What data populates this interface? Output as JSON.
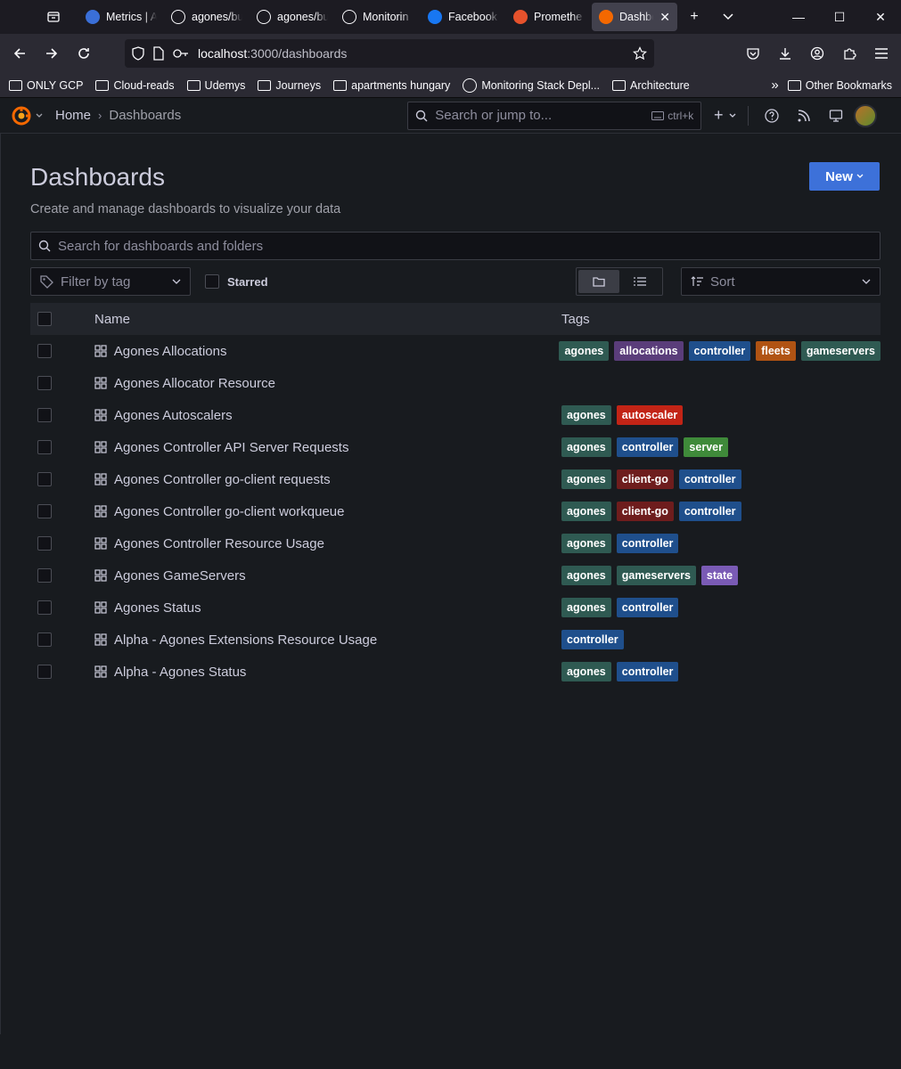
{
  "browser": {
    "tabs": [
      {
        "title": "Metrics | A",
        "icon": "azure-metrics-icon",
        "color": "#3a6fd8",
        "active": false
      },
      {
        "title": "agones/bu",
        "icon": "github-icon",
        "color": "#ffffff",
        "active": false
      },
      {
        "title": "agones/bu",
        "icon": "github-icon",
        "color": "#ffffff",
        "active": false
      },
      {
        "title": "Monitorin",
        "icon": "openai-icon",
        "color": "#ffffff",
        "active": false
      },
      {
        "title": "Facebook",
        "icon": "facebook-icon",
        "color": "#1877f2",
        "active": false
      },
      {
        "title": "Promethe",
        "icon": "prometheus-icon",
        "color": "#e6522c",
        "active": false
      },
      {
        "title": "Dashbo",
        "icon": "grafana-icon",
        "color": "#f46800",
        "active": true
      }
    ],
    "url_host": "localhost",
    "url_path": ":3000/dashboards",
    "bookmarks": [
      {
        "label": "ONLY GCP",
        "type": "folder"
      },
      {
        "label": "Cloud-reads",
        "type": "folder"
      },
      {
        "label": "Udemys",
        "type": "folder"
      },
      {
        "label": "Journeys",
        "type": "folder"
      },
      {
        "label": "apartments hungary",
        "type": "folder"
      },
      {
        "label": "Monitoring Stack Depl...",
        "type": "link"
      },
      {
        "label": "Architecture",
        "type": "folder"
      }
    ],
    "other_bookmarks": "Other Bookmarks"
  },
  "topbar": {
    "home": "Home",
    "current": "Dashboards",
    "search_placeholder": "Search or jump to...",
    "shortcut": "ctrl+k"
  },
  "page": {
    "title": "Dashboards",
    "subtitle": "Create and manage dashboards to visualize your data",
    "new_button": "New",
    "search_placeholder": "Search for dashboards and folders",
    "filter_by_tag": "Filter by tag",
    "starred": "Starred",
    "sort": "Sort",
    "col_name": "Name",
    "col_tags": "Tags"
  },
  "tag_colors": {
    "agones": "#2f5a52",
    "allocations": "#5a3d7a",
    "controller": "#1f4f8c",
    "fleets": "#b05313",
    "gameservers": "#2f5a52",
    "autoscaler": "#c22416",
    "server": "#3f8a3a",
    "client-go": "#6e1d1d",
    "state": "#7a5bb5"
  },
  "dashboards": [
    {
      "name": "Agones Allocations",
      "tags": [
        "agones",
        "allocations",
        "controller",
        "fleets",
        "gameservers"
      ]
    },
    {
      "name": "Agones Allocator Resource",
      "tags": []
    },
    {
      "name": "Agones Autoscalers",
      "tags": [
        "agones",
        "autoscaler"
      ]
    },
    {
      "name": "Agones Controller API Server Requests",
      "tags": [
        "agones",
        "controller",
        "server"
      ]
    },
    {
      "name": "Agones Controller go-client requests",
      "tags": [
        "agones",
        "client-go",
        "controller"
      ]
    },
    {
      "name": "Agones Controller go-client workqueue",
      "tags": [
        "agones",
        "client-go",
        "controller"
      ]
    },
    {
      "name": "Agones Controller Resource Usage",
      "tags": [
        "agones",
        "controller"
      ]
    },
    {
      "name": "Agones GameServers",
      "tags": [
        "agones",
        "gameservers",
        "state"
      ]
    },
    {
      "name": "Agones Status",
      "tags": [
        "agones",
        "controller"
      ]
    },
    {
      "name": "Alpha - Agones Extensions Resource Usage",
      "tags": [
        "controller"
      ]
    },
    {
      "name": "Alpha - Agones Status",
      "tags": [
        "agones",
        "controller"
      ]
    }
  ]
}
